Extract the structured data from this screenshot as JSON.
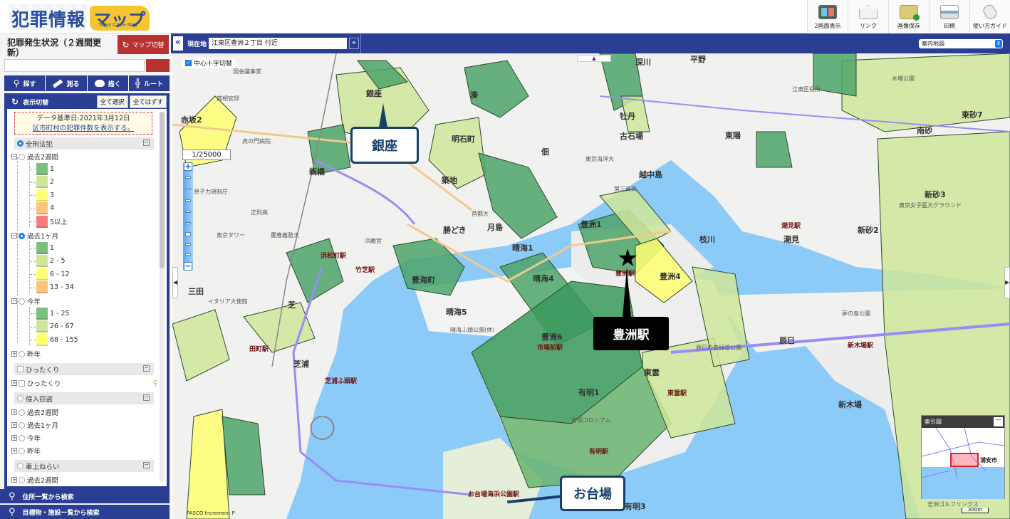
{
  "header": {
    "logo_main": "犯罪情報",
    "logo_kana": "マップ",
    "logo_sub": "Tokyo Crime Map",
    "toolbar": [
      {
        "id": "dual",
        "label": "2画面表示",
        "icon": "dual-screen-icon"
      },
      {
        "id": "link",
        "label": "リンク",
        "icon": "mail-link-icon"
      },
      {
        "id": "save",
        "label": "画像保存",
        "icon": "folder-save-icon"
      },
      {
        "id": "print",
        "label": "印刷",
        "icon": "printer-icon"
      },
      {
        "id": "guide",
        "label": "使い方ガイド",
        "icon": "mouse-guide-icon"
      }
    ]
  },
  "left": {
    "title": "犯罪発生状況（２週間更新）",
    "switch_button": "マップ切替",
    "search_value": "",
    "tools": [
      {
        "label": "探す",
        "icon": "search-icon"
      },
      {
        "label": "測る",
        "icon": "ruler-icon"
      },
      {
        "label": "描く",
        "icon": "palette-icon"
      },
      {
        "label": "ルート",
        "icon": "route-icon"
      }
    ],
    "layer_header": "表示切替",
    "select_all": "全て選択",
    "deselect_all": "全てはずす",
    "notice_date": "データ基準日:2021年3月12日",
    "notice_link": "区市町村の犯罪件数を表示する。",
    "categories": {
      "all_crime": "全刑法犯",
      "snatch": "ひったくり",
      "snatch_item": "ひったくり",
      "burglary": "侵入窃盗",
      "car": "車上ねらい"
    },
    "periods": {
      "two_weeks": "過去2週間",
      "one_month": "過去1ヶ月",
      "this_year": "今年",
      "last_year": "昨年"
    },
    "legend_two_weeks": [
      {
        "label": "1",
        "color": "#7dbf7d"
      },
      {
        "label": "2",
        "color": "#cfe69a"
      },
      {
        "label": "3",
        "color": "#ffff73"
      },
      {
        "label": "4",
        "color": "#ffc47a"
      },
      {
        "label": "5以上",
        "color": "#ff7a7a"
      }
    ],
    "legend_one_month": [
      {
        "label": "1",
        "color": "#7dbf7d"
      },
      {
        "label": "2 - 5",
        "color": "#cfe69a"
      },
      {
        "label": "6 - 12",
        "color": "#ffff73"
      },
      {
        "label": "13 - 34",
        "color": "#ffc47a"
      }
    ],
    "legend_this_year": [
      {
        "label": "1 - 25",
        "color": "#7dbf7d"
      },
      {
        "label": "26 - 67",
        "color": "#cfe69a"
      },
      {
        "label": "68 - 155",
        "color": "#ffff73"
      }
    ],
    "selected_period": "過去1ヶ月",
    "bottom_buttons": [
      "住所一覧から検索",
      "目標物・施設一覧から検索"
    ]
  },
  "mapbar": {
    "location_label": "現在地",
    "location_value": "江東区豊洲２丁目 付近",
    "map_type": "案内地図"
  },
  "map": {
    "crosshair_label": "中心十字切替",
    "crosshair_checked": true,
    "scale": "1/25000",
    "scale_bar": "300m",
    "attribution": "PASCO Increment P",
    "overview_title": "索引図",
    "overview_label": "浦安市",
    "callouts": {
      "ginza": "銀座",
      "toyosu": "豊洲駅",
      "odaiba": "お台場"
    },
    "place_labels": [
      "赤坂2",
      "新橋",
      "銀座",
      "湊",
      "明石町",
      "築地",
      "月島",
      "佃",
      "古石場",
      "越中島",
      "牡丹",
      "深川",
      "豊洲1",
      "豊洲4",
      "豊洲6",
      "晴海1",
      "晴海4",
      "晴海5",
      "豊海町",
      "勝どき",
      "三田",
      "芝",
      "芝浦",
      "有明1",
      "東雲",
      "辰巳",
      "新木場",
      "潮見",
      "新砂2",
      "新砂3",
      "南砂",
      "東砂7",
      "東陽",
      "枝川",
      "平野",
      "有明3"
    ],
    "station_labels": [
      "浜松町駅",
      "竹芝駅",
      "田町駅",
      "芝浦ふ頭駅",
      "市場前駅",
      "豊洲駅",
      "東雲駅",
      "有明駅",
      "新木場駅",
      "潮見駅",
      "お台場海浜公園駅"
    ],
    "facility_labels": [
      "国会議事堂",
      "首相官邸",
      "虎の門病院",
      "原子力規制庁",
      "正則高",
      "東京タワー",
      "慶應義塾大",
      "イタリア大使館",
      "浜離宮",
      "晴海ふ頭公園(休)",
      "東京海洋大",
      "第三商高",
      "首都大",
      "江東区役所",
      "木場公園",
      "夢の島公園",
      "東京女子医大グラウンド",
      "有明コロシアム",
      "辰巳の森緑道公園",
      "若洲ゴルフリンクス"
    ]
  }
}
